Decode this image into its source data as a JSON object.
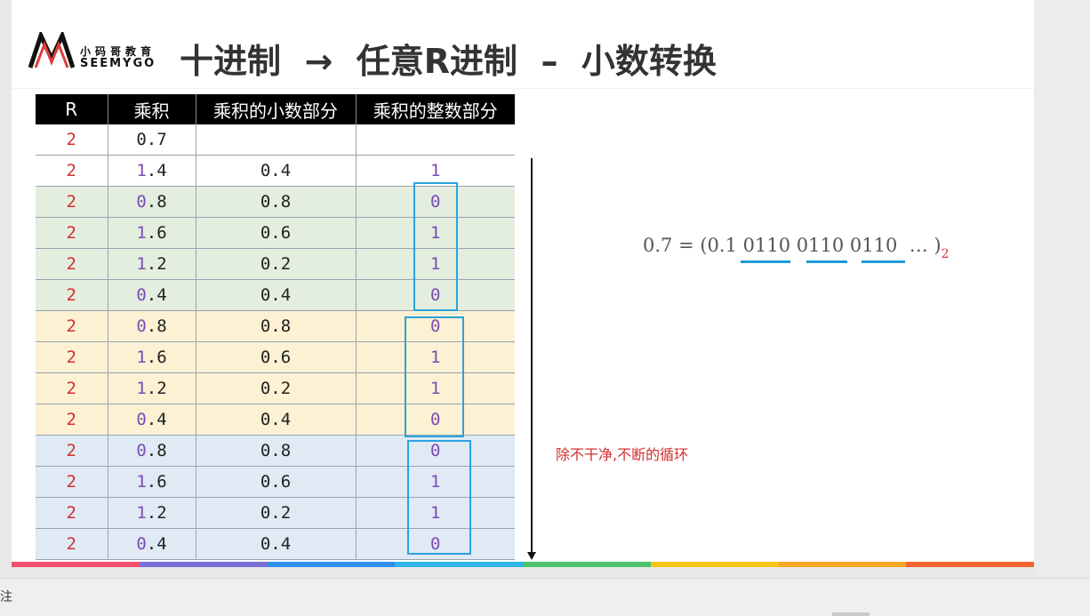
{
  "header": {
    "title": "十进制  →  任意R进制  –  小数转换",
    "logo_cn": "小码哥教育",
    "logo_en": "SEEMYGO"
  },
  "table": {
    "headers": [
      "R",
      "乘积",
      "乘积的小数部分",
      "乘积的整数部分"
    ],
    "rows": [
      {
        "r": "2",
        "product_int": "",
        "product_frac": "0.7",
        "frac": "",
        "int": "",
        "group": "white"
      },
      {
        "r": "2",
        "product_int": "1",
        "product_frac": ".4",
        "frac": "0.4",
        "int": "1",
        "group": "white"
      },
      {
        "r": "2",
        "product_int": "0",
        "product_frac": ".8",
        "frac": "0.8",
        "int": "0",
        "group": "green"
      },
      {
        "r": "2",
        "product_int": "1",
        "product_frac": ".6",
        "frac": "0.6",
        "int": "1",
        "group": "green"
      },
      {
        "r": "2",
        "product_int": "1",
        "product_frac": ".2",
        "frac": "0.2",
        "int": "1",
        "group": "green"
      },
      {
        "r": "2",
        "product_int": "0",
        "product_frac": ".4",
        "frac": "0.4",
        "int": "0",
        "group": "green"
      },
      {
        "r": "2",
        "product_int": "0",
        "product_frac": ".8",
        "frac": "0.8",
        "int": "0",
        "group": "yellow"
      },
      {
        "r": "2",
        "product_int": "1",
        "product_frac": ".6",
        "frac": "0.6",
        "int": "1",
        "group": "yellow"
      },
      {
        "r": "2",
        "product_int": "1",
        "product_frac": ".2",
        "frac": "0.2",
        "int": "1",
        "group": "yellow"
      },
      {
        "r": "2",
        "product_int": "0",
        "product_frac": ".4",
        "frac": "0.4",
        "int": "0",
        "group": "yellow"
      },
      {
        "r": "2",
        "product_int": "0",
        "product_frac": ".8",
        "frac": "0.8",
        "int": "0",
        "group": "blue"
      },
      {
        "r": "2",
        "product_int": "1",
        "product_frac": ".6",
        "frac": "0.6",
        "int": "1",
        "group": "blue"
      },
      {
        "r": "2",
        "product_int": "1",
        "product_frac": ".2",
        "frac": "0.2",
        "int": "1",
        "group": "blue"
      },
      {
        "r": "2",
        "product_int": "0",
        "product_frac": ".4",
        "frac": "0.4",
        "int": "0",
        "group": "blue"
      }
    ]
  },
  "formula": {
    "lhs": "0.7 = (0.1 ",
    "groups": [
      "0110",
      "0110",
      "0110"
    ],
    "tail": "  … )",
    "subscript": "2"
  },
  "note": "除不干净,不断的循环",
  "bottom": {
    "notes_label": "注"
  },
  "colors": {
    "accent_red": "#d32f2f",
    "integer_purple": "#7b4cb5",
    "box_blue": "#29a3e0",
    "stripe": [
      "#f0506e",
      "#7a6fd6",
      "#2f8fe8",
      "#2fb3e8",
      "#4cc26b",
      "#f5c518",
      "#f5a623",
      "#f26430"
    ]
  }
}
